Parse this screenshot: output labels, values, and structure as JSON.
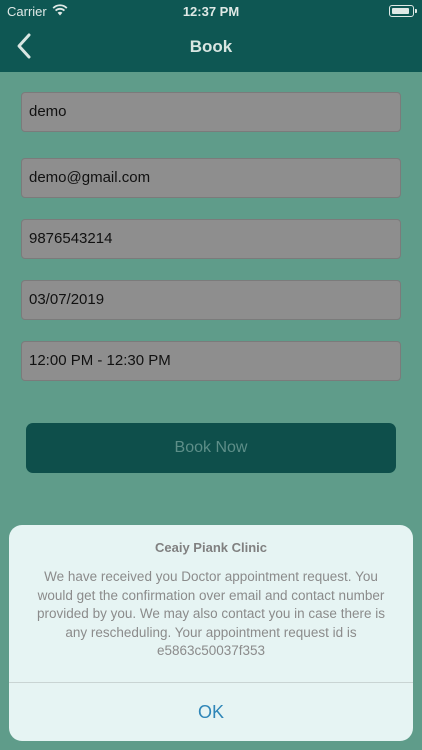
{
  "status_bar": {
    "carrier": "Carrier",
    "time": "12:37 PM"
  },
  "nav": {
    "title": "Book",
    "back_icon": "chevron-left-icon"
  },
  "form": {
    "name_value": "demo",
    "email_value": "demo@gmail.com",
    "phone_value": "9876543214",
    "date_value": "03/07/2019",
    "time_slot_value": "12:00 PM - 12:30 PM",
    "book_button": "Book Now"
  },
  "alert": {
    "title": "Ceaiy Piank Clinic",
    "message": "We have received you Doctor appointment request. You would get the confirmation over email and contact number provided by you. We may also contact you in case there is any rescheduling. Your appointment request id is e5863c50037f353",
    "ok_button": "OK"
  },
  "colors": {
    "nav_bar": "#0e5753",
    "background": "#5f9c8a",
    "button": "#0e4f4b",
    "alert_background": "#e6f4f3",
    "alert_action": "#2f86b8"
  }
}
